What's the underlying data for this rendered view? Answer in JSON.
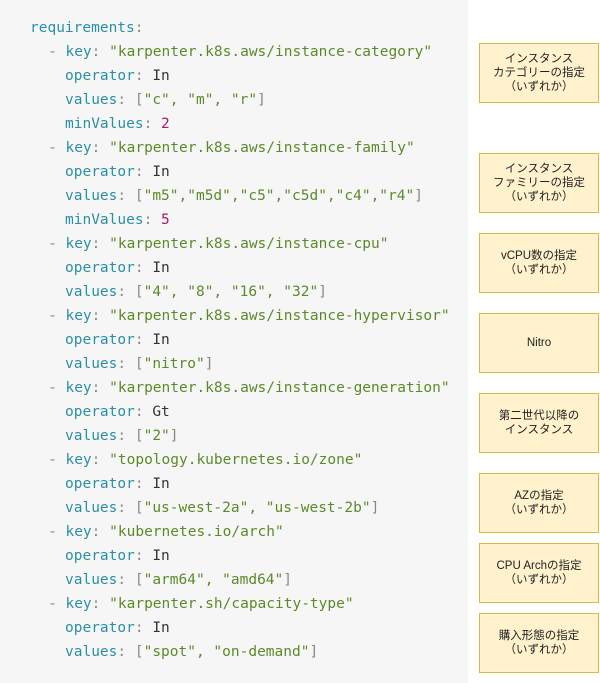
{
  "code": {
    "root_key": "requirements",
    "items": [
      {
        "key": "karpenter.k8s.aws/instance-category",
        "operator": "In",
        "values": "\"c\", \"m\", \"r\"",
        "min_values": "2"
      },
      {
        "key": "karpenter.k8s.aws/instance-family",
        "operator": "In",
        "values": "\"m5\",\"m5d\",\"c5\",\"c5d\",\"c4\",\"r4\"",
        "min_values": "5"
      },
      {
        "key": "karpenter.k8s.aws/instance-cpu",
        "operator": "In",
        "values": "\"4\", \"8\", \"16\", \"32\""
      },
      {
        "key": "karpenter.k8s.aws/instance-hypervisor",
        "operator": "In",
        "values": "\"nitro\""
      },
      {
        "key": "karpenter.k8s.aws/instance-generation",
        "operator": "Gt",
        "values": "\"2\""
      },
      {
        "key": "topology.kubernetes.io/zone",
        "operator": "In",
        "values": "\"us-west-2a\", \"us-west-2b\""
      },
      {
        "key": "kubernetes.io/arch",
        "operator": "In",
        "values": "\"arm64\", \"amd64\""
      },
      {
        "key": "karpenter.sh/capacity-type",
        "operator": "In",
        "values": "\"spot\", \"on-demand\""
      }
    ]
  },
  "notes": [
    "インスタンス\nカテゴリーの指定\n（いずれか）",
    "インスタンス\nファミリーの指定\n（いずれか）",
    "vCPU数の指定\n（いずれか）",
    "Nitro",
    "第二世代以降の\nインスタンス",
    "AZの指定\n（いずれか）",
    "CPU Archの指定\n（いずれか）",
    "購入形態の指定\n（いずれか）"
  ]
}
